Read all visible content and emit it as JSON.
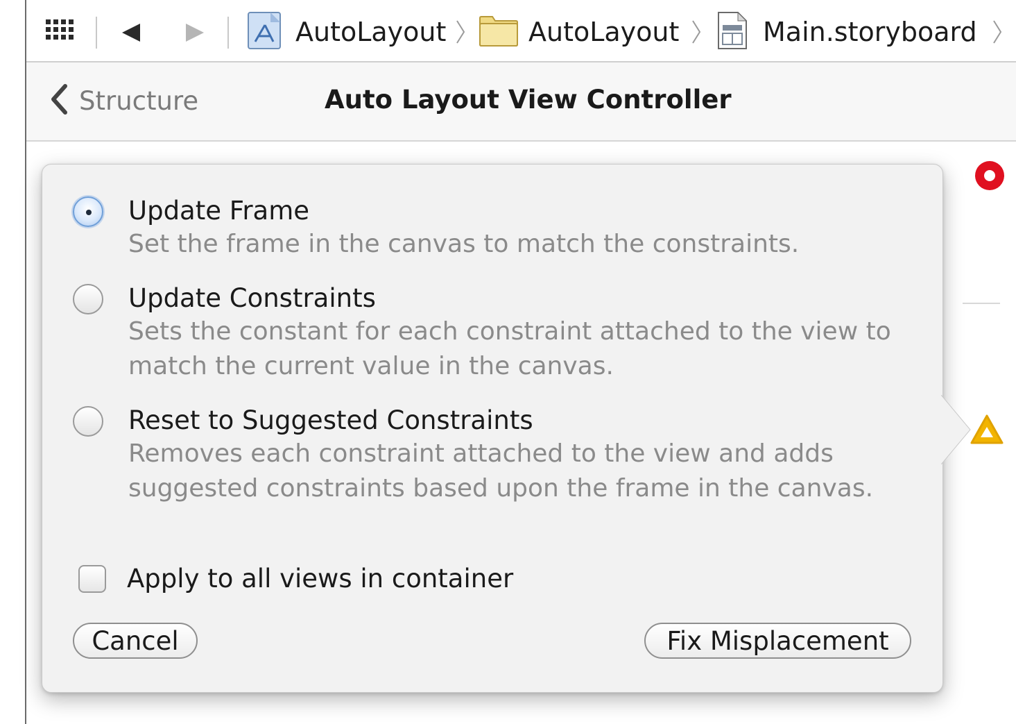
{
  "jump_bar": {
    "crumbs": [
      {
        "label": "AutoLayout",
        "icon": "project-icon"
      },
      {
        "label": "AutoLayout",
        "icon": "folder-icon"
      },
      {
        "label": "Main.storyboard",
        "icon": "storyboard-file-icon"
      }
    ]
  },
  "header": {
    "back_label": "Structure",
    "title": "Auto Layout View Controller"
  },
  "popover": {
    "options": [
      {
        "title": "Update Frame",
        "description": "Set the frame in the canvas to match the constraints.",
        "selected": true
      },
      {
        "title": "Update Constraints",
        "description": "Sets the constant for each constraint attached to the view to match the current value in the canvas.",
        "selected": false
      },
      {
        "title": "Reset to Suggested Constraints",
        "description": "Removes each constraint attached to the view and adds suggested constraints based upon the frame in the canvas.",
        "selected": false
      }
    ],
    "apply_all_label": "Apply to all views in container",
    "apply_all_checked": false,
    "cancel_label": "Cancel",
    "fix_label": "Fix Misplacement"
  },
  "colors": {
    "error": "#e01020",
    "warning": "#f2b400",
    "selection": "#6f9fd8"
  }
}
